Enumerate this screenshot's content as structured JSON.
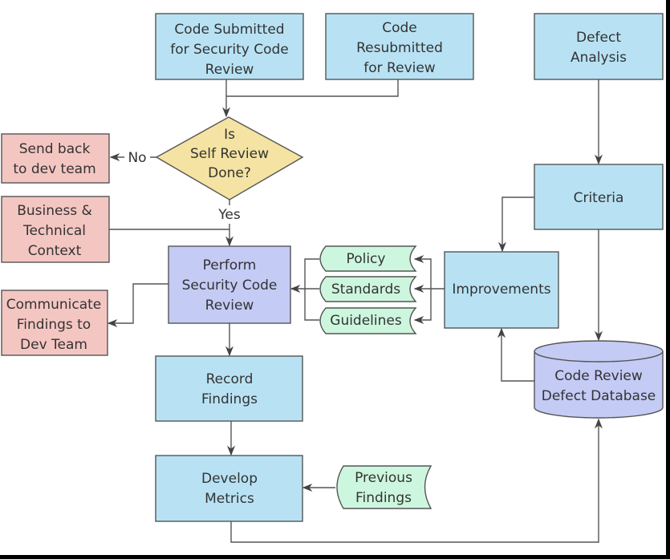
{
  "colors": {
    "process": "#b8e2f4",
    "external": "#f4c6c2",
    "decision": "#f4e3a2",
    "core": "#c4cbf5",
    "document": "#cdf6de",
    "line": "#555555"
  },
  "nodes": {
    "code_submitted": [
      "Code Submitted",
      "for Security Code",
      "Review"
    ],
    "code_resubmitted": [
      "Code",
      "Resubmitted",
      "for Review"
    ],
    "defect_analysis": [
      "Defect",
      "Analysis"
    ],
    "decision": [
      "Is",
      "Self Review",
      "Done?"
    ],
    "send_back": [
      "Send back",
      "to dev team"
    ],
    "business_context": [
      "Business &",
      "Technical",
      "Context"
    ],
    "perform_review": [
      "Perform",
      "Security Code",
      "Review"
    ],
    "communicate": [
      "Communicate",
      "Findings to",
      "Dev Team"
    ],
    "record_findings": [
      "Record",
      "Findings"
    ],
    "develop_metrics": [
      "Develop",
      "Metrics"
    ],
    "previous_findings": [
      "Previous",
      "Findings"
    ],
    "policy": [
      "Policy"
    ],
    "standards": [
      "Standards"
    ],
    "guidelines": [
      "Guidelines"
    ],
    "improvements": [
      "Improvements"
    ],
    "criteria": [
      "Criteria"
    ],
    "database": [
      "Code Review",
      "Defect Database"
    ]
  },
  "edge_labels": {
    "no": "No",
    "yes": "Yes"
  }
}
